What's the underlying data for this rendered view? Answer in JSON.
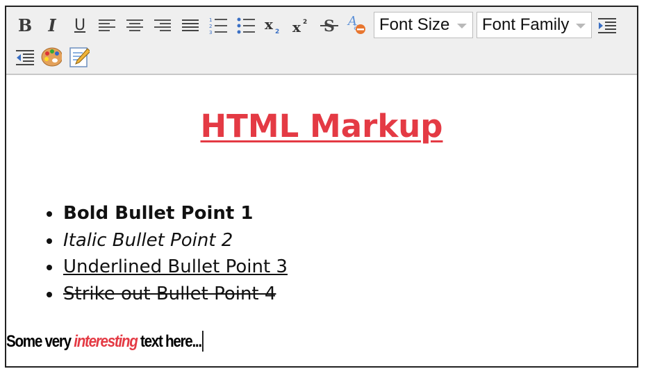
{
  "toolbar": {
    "buttons": [
      {
        "name": "bold-icon",
        "glyph": "B"
      },
      {
        "name": "italic-icon",
        "glyph": "I"
      },
      {
        "name": "underline-icon",
        "glyph": "U"
      },
      {
        "name": "align-left-icon"
      },
      {
        "name": "align-center-icon"
      },
      {
        "name": "align-right-icon"
      },
      {
        "name": "align-justify-icon"
      },
      {
        "name": "ordered-list-icon"
      },
      {
        "name": "unordered-list-icon"
      },
      {
        "name": "subscript-icon"
      },
      {
        "name": "superscript-icon"
      },
      {
        "name": "strikethrough-icon"
      },
      {
        "name": "remove-format-icon"
      },
      {
        "name": "indent-icon"
      },
      {
        "name": "outdent-icon"
      },
      {
        "name": "color-palette-icon"
      },
      {
        "name": "edit-html-icon"
      }
    ],
    "font_size_label": "Font Size",
    "font_family_label": "Font Family"
  },
  "document": {
    "heading": "HTML Markup",
    "bullets": [
      "Bold Bullet Point 1",
      "Italic Bullet Point 2",
      "Underlined Bullet Point 3",
      "Strike out Bullet Point 4"
    ],
    "paragraph": {
      "before": "Some very ",
      "highlight": "interesting",
      "after": " text here..."
    }
  },
  "colors": {
    "heading": "#e43a44",
    "highlight": "#e43a44",
    "toolbar_bg": "#efefef"
  }
}
